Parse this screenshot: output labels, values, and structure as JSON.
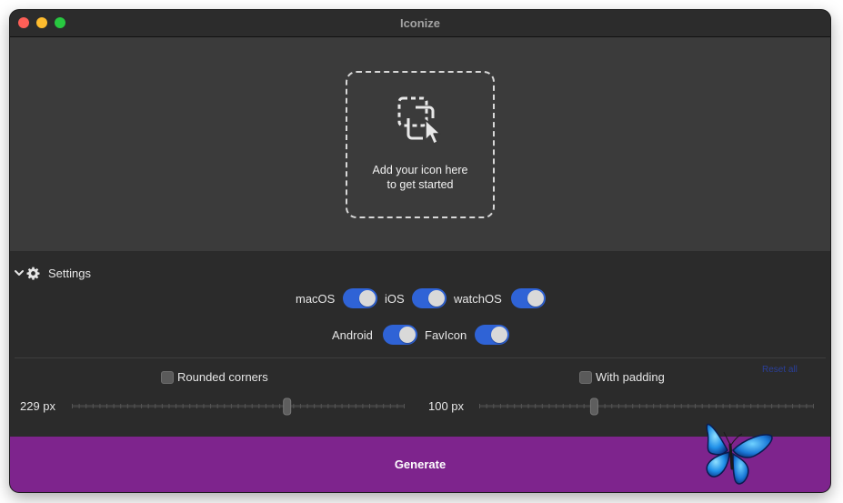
{
  "window": {
    "title": "Iconize"
  },
  "dropzone": {
    "line1": "Add your icon here",
    "line2": "to get started",
    "icon": "select-image-cursor-icon"
  },
  "settings": {
    "label": "Settings",
    "expanded": true,
    "platforms": [
      {
        "label": "macOS",
        "enabled": true
      },
      {
        "label": "iOS",
        "enabled": true
      },
      {
        "label": "watchOS",
        "enabled": true
      },
      {
        "label": "Android",
        "enabled": true
      },
      {
        "label": "FavIcon",
        "enabled": true
      }
    ],
    "rounded_corners": {
      "label": "Rounded corners",
      "checked": false,
      "value_label": "229 px",
      "slider_fraction": 0.65
    },
    "with_padding": {
      "label": "With padding",
      "checked": false,
      "value_label": "100 px",
      "slider_fraction": 0.34
    },
    "faint_link": "Reset all"
  },
  "generate": {
    "label": "Generate"
  },
  "colors": {
    "accent_toggle": "#2f63d6",
    "generate_bar": "#7e248d",
    "dropzone_bg": "#3b3b3b",
    "window_bg": "#2b2b2b"
  }
}
